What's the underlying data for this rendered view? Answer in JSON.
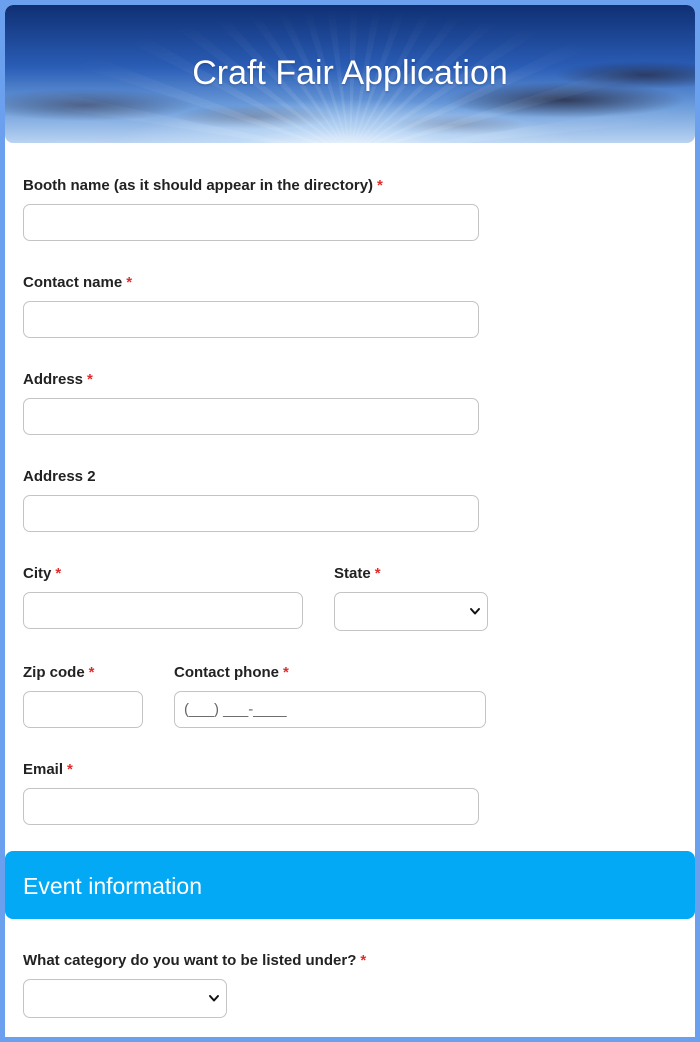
{
  "header": {
    "title": "Craft Fair Application"
  },
  "fields": {
    "booth_name": {
      "label": "Booth name (as it should appear in the directory)",
      "required": "*",
      "value": ""
    },
    "contact_name": {
      "label": "Contact name",
      "required": "*",
      "value": ""
    },
    "address": {
      "label": "Address",
      "required": "*",
      "value": ""
    },
    "address2": {
      "label": "Address 2",
      "value": ""
    },
    "city": {
      "label": "City",
      "required": "*",
      "value": ""
    },
    "state": {
      "label": "State",
      "required": "*",
      "selected": ""
    },
    "zip": {
      "label": "Zip code",
      "required": "*",
      "value": ""
    },
    "phone": {
      "label": "Contact phone",
      "required": "*",
      "placeholder": "(___) ___-____"
    },
    "email": {
      "label": "Email",
      "required": "*",
      "value": ""
    }
  },
  "section": {
    "title": "Event information"
  },
  "event": {
    "category": {
      "label": "What category do you want to be listed under?",
      "required": "*",
      "selected": ""
    }
  },
  "colors": {
    "accent": "#03a9f4",
    "required": "#e02b2b",
    "border": "#6aa0ee"
  },
  "icons": {
    "select_arrow": "chevron-down-icon"
  }
}
